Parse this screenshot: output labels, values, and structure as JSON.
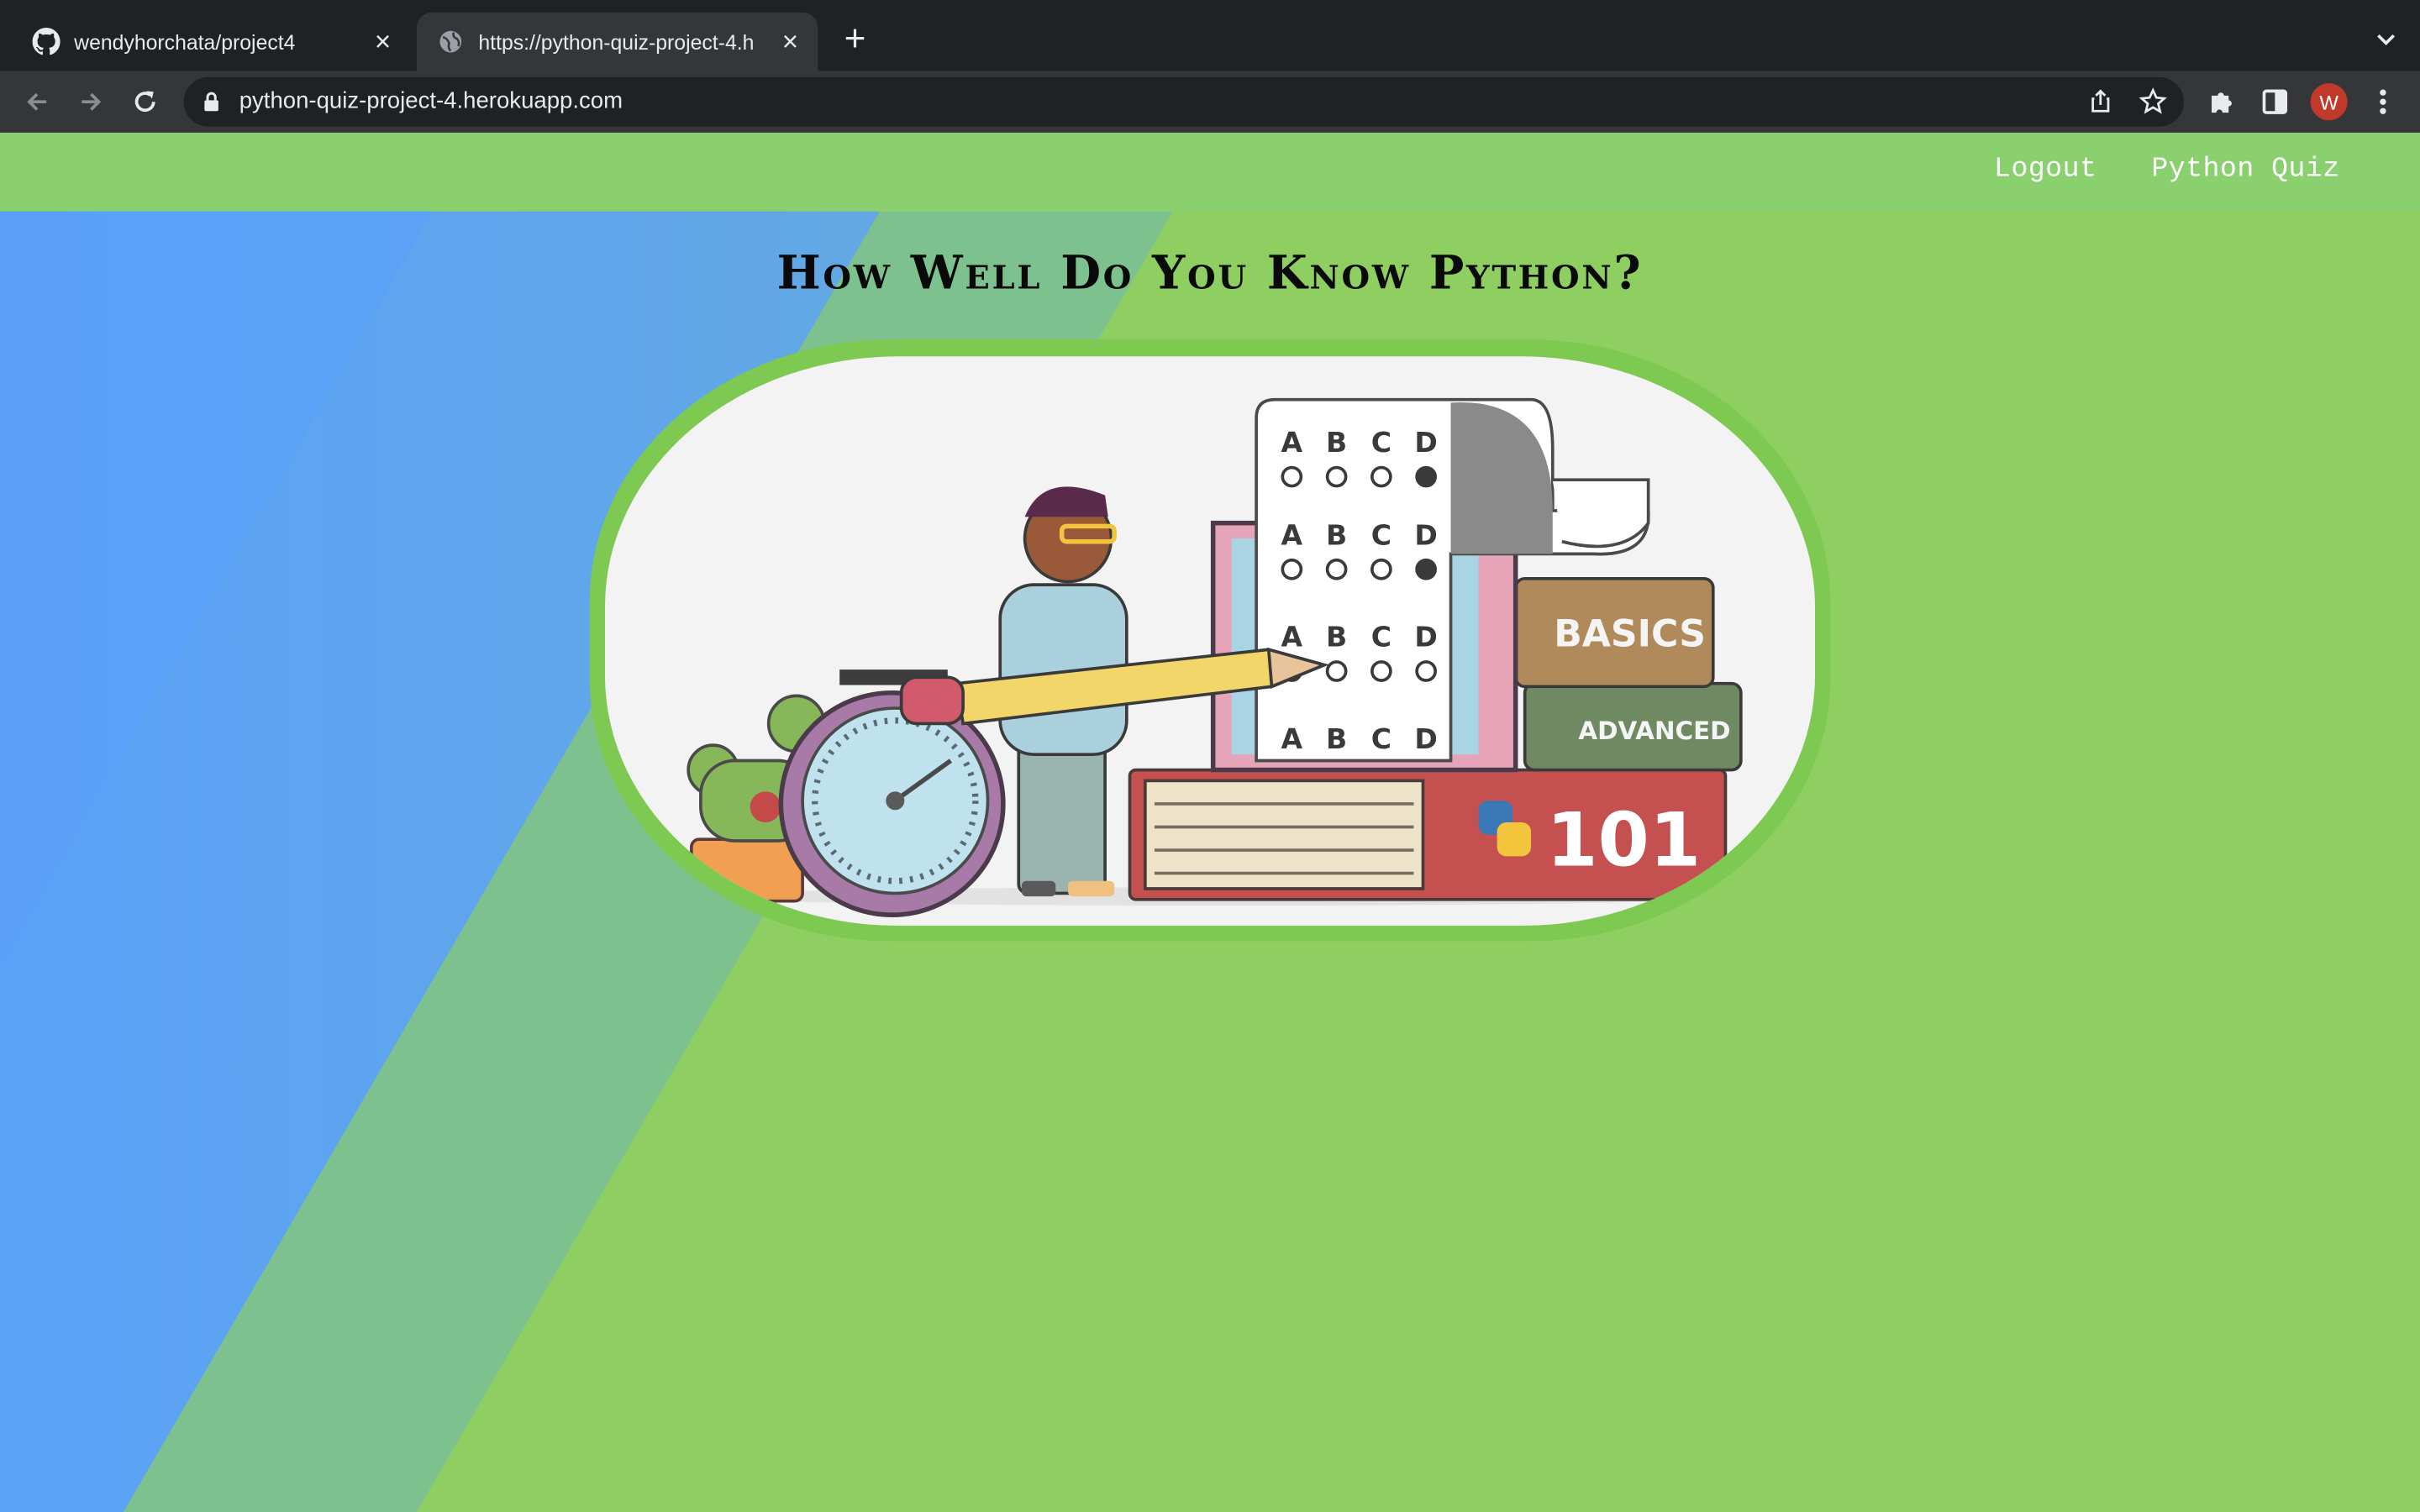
{
  "browser": {
    "tabs": [
      {
        "title": "wendyhorchata/project4",
        "favicon": "github-icon",
        "active": false
      },
      {
        "title": "https://python-quiz-project-4.h",
        "favicon": "globe-icon",
        "active": true
      }
    ],
    "url": "python-quiz-project-4.herokuapp.com",
    "profile_initial": "W"
  },
  "site": {
    "nav": {
      "logout": "Logout",
      "quiz": "Python Quiz"
    },
    "headline": "How Well Do You Know Python?",
    "hero_image": {
      "sheet_rows": [
        {
          "letters": [
            "A",
            "B",
            "C",
            "D"
          ],
          "selected": "D"
        },
        {
          "letters": [
            "A",
            "B",
            "C",
            "D"
          ],
          "selected": "D"
        },
        {
          "letters": [
            "A",
            "B",
            "C",
            "D"
          ],
          "selected": "A"
        },
        {
          "letters": [
            "A",
            "B",
            "C",
            "D"
          ],
          "selected": ""
        }
      ],
      "book_basics": "BASICS",
      "book_advanced": "ADVANCED",
      "book_101": "101"
    }
  },
  "colors": {
    "page_green": "#8dd060",
    "nav_green": "#8ad06f",
    "blue_band": "#5aa2f0",
    "frame_green": "#7dc952"
  }
}
